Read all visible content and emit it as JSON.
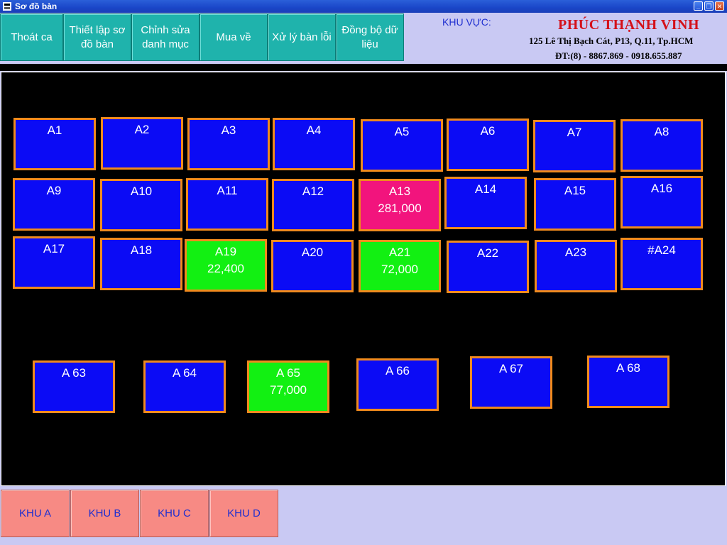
{
  "window": {
    "title": "Sơ đồ bàn",
    "buttons": [
      "minimize",
      "restore",
      "close"
    ]
  },
  "toolbar": {
    "buttons": [
      {
        "label": "Thoát ca"
      },
      {
        "label": "Thiết lập sơ đồ bàn"
      },
      {
        "label": "Chỉnh sửa danh mục"
      },
      {
        "label": "Mua về"
      },
      {
        "label": "Xử lý bàn lỗi"
      },
      {
        "label": "Đồng bộ dữ liệu"
      }
    ],
    "area_label": "KHU VỰC:"
  },
  "brand": {
    "name": "PHÚC THẠNH VINH",
    "address": "125 Lê Thị Bạch Cát, P13, Q.11, Tp.HCM",
    "phone": "ĐT:(8) - 8867.869 - 0918.655.887"
  },
  "colors": {
    "empty_table": "#0b0bf5",
    "paid_table": "#12f012",
    "pending_table": "#f2147d",
    "table_border": "#f08a1d"
  },
  "tables": [
    {
      "name": "A1",
      "amount": "",
      "status": "empty"
    },
    {
      "name": "A2",
      "amount": "",
      "status": "empty"
    },
    {
      "name": "A3",
      "amount": "",
      "status": "empty"
    },
    {
      "name": "A4",
      "amount": "",
      "status": "empty"
    },
    {
      "name": "A5",
      "amount": "",
      "status": "empty"
    },
    {
      "name": "A6",
      "amount": "",
      "status": "empty"
    },
    {
      "name": "A7",
      "amount": "",
      "status": "empty"
    },
    {
      "name": "A8",
      "amount": "",
      "status": "empty"
    },
    {
      "name": "A9",
      "amount": "",
      "status": "empty"
    },
    {
      "name": "A10",
      "amount": "",
      "status": "empty"
    },
    {
      "name": "A11",
      "amount": "",
      "status": "empty"
    },
    {
      "name": "A12",
      "amount": "",
      "status": "empty"
    },
    {
      "name": "A13",
      "amount": "281,000",
      "status": "pink"
    },
    {
      "name": "A14",
      "amount": "",
      "status": "empty"
    },
    {
      "name": "A15",
      "amount": "",
      "status": "empty"
    },
    {
      "name": "A16",
      "amount": "",
      "status": "empty"
    },
    {
      "name": "A17",
      "amount": "",
      "status": "empty"
    },
    {
      "name": "A18",
      "amount": "",
      "status": "empty"
    },
    {
      "name": "A19",
      "amount": "22,400",
      "status": "green"
    },
    {
      "name": "A20",
      "amount": "",
      "status": "empty"
    },
    {
      "name": "A21",
      "amount": "72,000",
      "status": "green"
    },
    {
      "name": "A22",
      "amount": "",
      "status": "empty"
    },
    {
      "name": "A23",
      "amount": "",
      "status": "empty"
    },
    {
      "name": "#A24",
      "amount": "",
      "status": "empty"
    },
    {
      "name": "A 63",
      "amount": "",
      "status": "empty"
    },
    {
      "name": "A 64",
      "amount": "",
      "status": "empty"
    },
    {
      "name": "A 65",
      "amount": "77,000",
      "status": "green"
    },
    {
      "name": "A 66",
      "amount": "",
      "status": "empty"
    },
    {
      "name": "A 67",
      "amount": "",
      "status": "empty"
    },
    {
      "name": "A 68",
      "amount": "",
      "status": "empty"
    }
  ],
  "areas": [
    {
      "label": "KHU A"
    },
    {
      "label": "KHU B"
    },
    {
      "label": "KHU C"
    },
    {
      "label": "KHU D"
    }
  ]
}
